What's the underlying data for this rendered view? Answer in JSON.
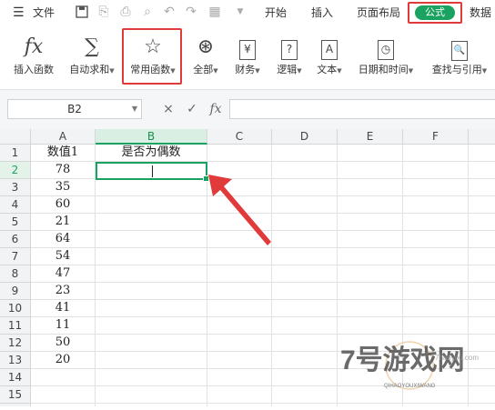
{
  "menubar": {
    "menu_icon": "hamburger-icon",
    "file_label": "文件",
    "tabs": [
      {
        "label": "开始"
      },
      {
        "label": "插入"
      },
      {
        "label": "页面布局"
      },
      {
        "label": "公式",
        "active": true
      },
      {
        "label": "数据"
      }
    ],
    "quick_icons": [
      "save-icon",
      "export-icon",
      "print-icon",
      "print-preview-icon",
      "undo-icon",
      "redo-icon",
      "format-painter-icon",
      "more-icon"
    ],
    "active_color": "#1aa260",
    "highlight_color": "#e03a3a"
  },
  "ribbon": {
    "buttons": [
      {
        "label": "插入函数",
        "icon": "fx-icon",
        "glyph": "fx"
      },
      {
        "label": "自动求和",
        "icon": "sigma-icon",
        "glyph": "∑"
      },
      {
        "label": "常用函数",
        "icon": "star-icon",
        "glyph": "☆"
      },
      {
        "label": "全部",
        "icon": "asterisk-icon",
        "glyph": "⊛"
      },
      {
        "label": "财务",
        "icon": "finance-icon",
        "glyph": "¥"
      },
      {
        "label": "逻辑",
        "icon": "logic-icon",
        "glyph": "?"
      },
      {
        "label": "文本",
        "icon": "text-icon",
        "glyph": "A"
      },
      {
        "label": "日期和时间",
        "icon": "clock-icon",
        "glyph": "◷"
      },
      {
        "label": "查找与引用",
        "icon": "lookup-icon",
        "glyph": "🔍"
      }
    ]
  },
  "formula_bar": {
    "name_box": "B2",
    "cancel_glyph": "×",
    "confirm_glyph": "✓",
    "fx_glyph": "fx",
    "value": ""
  },
  "sheet": {
    "columns": [
      "A",
      "B",
      "C",
      "D",
      "E",
      "F"
    ],
    "selected_column": "B",
    "selected_row": "2",
    "rows": [
      {
        "num": "1",
        "a": "数值1",
        "b": "是否为偶数"
      },
      {
        "num": "2",
        "a": "78",
        "b": ""
      },
      {
        "num": "3",
        "a": "35",
        "b": ""
      },
      {
        "num": "4",
        "a": "60",
        "b": ""
      },
      {
        "num": "5",
        "a": "21",
        "b": ""
      },
      {
        "num": "6",
        "a": "64",
        "b": ""
      },
      {
        "num": "7",
        "a": "54",
        "b": ""
      },
      {
        "num": "8",
        "a": "47",
        "b": ""
      },
      {
        "num": "9",
        "a": "23",
        "b": ""
      },
      {
        "num": "10",
        "a": "41",
        "b": ""
      },
      {
        "num": "11",
        "a": "11",
        "b": ""
      },
      {
        "num": "12",
        "a": "50",
        "b": ""
      },
      {
        "num": "13",
        "a": "20",
        "b": ""
      },
      {
        "num": "14",
        "a": "",
        "b": ""
      },
      {
        "num": "15",
        "a": "",
        "b": ""
      },
      {
        "num": "16",
        "a": "",
        "b": ""
      }
    ]
  },
  "watermark": {
    "brand": "7号游戏网",
    "sub": "QIHAOYOUXIWANG",
    "url": "7haoyou.com"
  }
}
